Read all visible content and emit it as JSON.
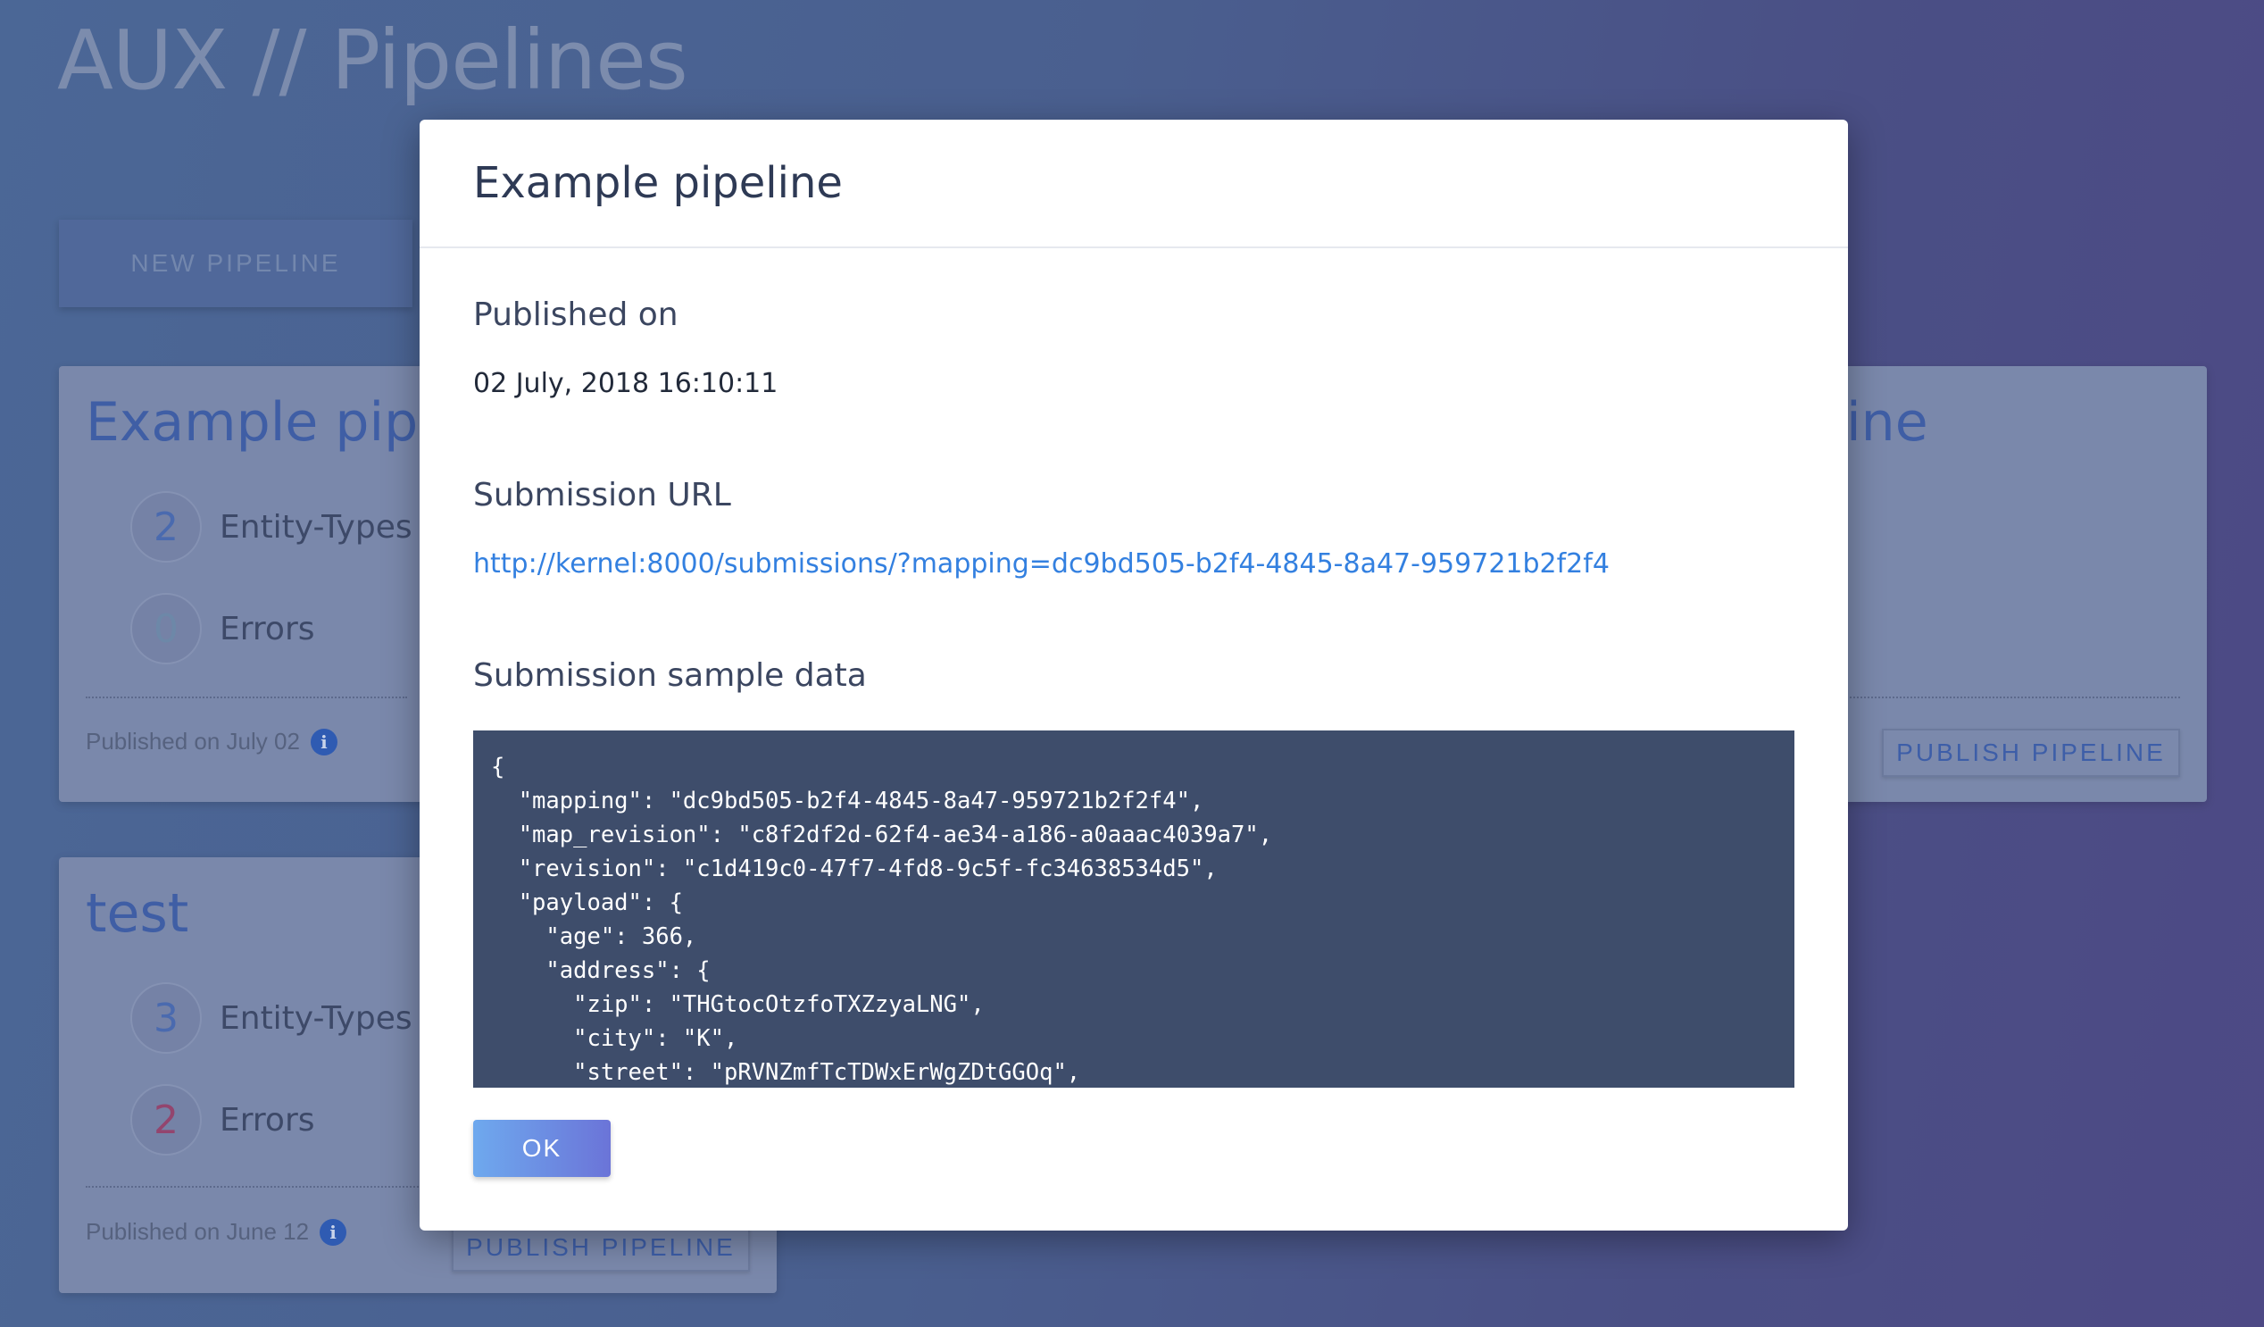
{
  "app": {
    "title": "AUX // Pipelines"
  },
  "toolbar": {
    "new_pipeline_label": "NEW PIPELINE"
  },
  "background_cards": [
    {
      "title": "Example pipel",
      "entity_types_count": "2",
      "entity_types_label": "Entity-Types",
      "errors_count": "0",
      "errors_label": "Errors",
      "published_text": "Published on July 02"
    },
    {
      "title": "test",
      "entity_types_count": "3",
      "entity_types_label": "Entity-Types",
      "errors_count": "2",
      "errors_label": "Errors",
      "published_text": "Published on June 12",
      "publish_button_label": "PUBLISH PIPELINE"
    },
    {
      "title": "ine",
      "publish_button_label": "PUBLISH PIPELINE"
    }
  ],
  "modal": {
    "title": "Example pipeline",
    "published_on_label": "Published on",
    "published_on_value": "02 July, 2018 16:10:11",
    "submission_url_label": "Submission URL",
    "submission_url": "http://kernel:8000/submissions/?mapping=dc9bd505-b2f4-4845-8a47-959721b2f2f4",
    "sample_data_label": "Submission sample data",
    "sample_data_code": "{\n  \"mapping\": \"dc9bd505-b2f4-4845-8a47-959721b2f2f4\",\n  \"map_revision\": \"c8f2df2d-62f4-ae34-a186-a0aaac4039a7\",\n  \"revision\": \"c1d419c0-47f7-4fd8-9c5f-fc34638534d5\",\n  \"payload\": {\n    \"age\": 366,\n    \"address\": {\n      \"zip\": \"THGtocOtzfoTXZzyaLNG\",\n      \"city\": \"K\",\n      \"street\": \"pRVNZmfTcTDWxErWgZDtGGOq\",",
    "ok_label": "OK"
  },
  "icons": {
    "info": "info-icon"
  },
  "colors": {
    "accent": "#3380e0",
    "code_bg": "#3e4d6b",
    "error": "#93456e"
  }
}
